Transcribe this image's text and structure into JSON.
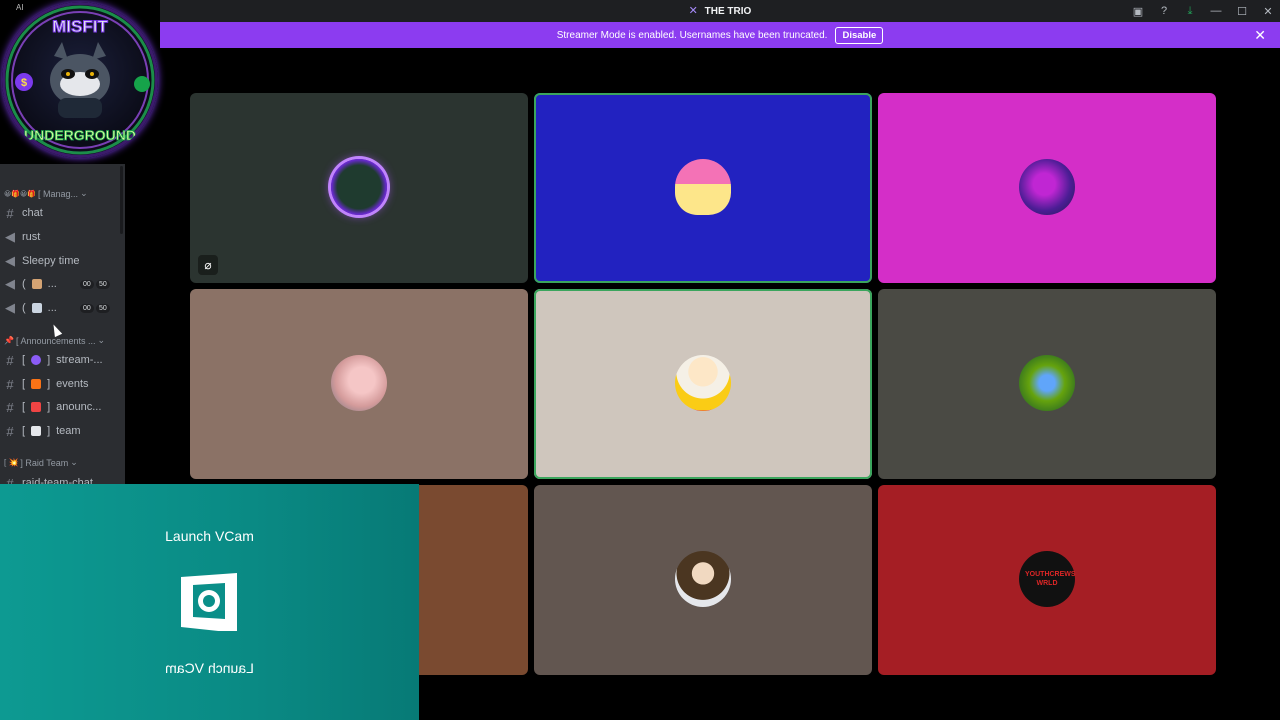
{
  "window": {
    "title": "THE TRIO",
    "controls": [
      "inbox-icon",
      "help-icon",
      "download-icon",
      "minimize-icon",
      "maximize-icon",
      "close-icon"
    ]
  },
  "banner": {
    "message": "Streamer Mode is enabled. Usernames have been truncated.",
    "button_label": "Disable",
    "background": "#8c3cf0"
  },
  "server": {
    "ai_tag": "AI",
    "logo_top_text": "MISFIT",
    "logo_bottom_text": "UNDERGROUND"
  },
  "sidebar": {
    "categories": [
      {
        "label": "[ Manag...",
        "prefix": "😀🎁😀🎁"
      },
      {
        "label": "[ Announcements ...",
        "prefix": "📌"
      },
      {
        "label": "] Raid Team",
        "prefix": "[ 💥"
      }
    ],
    "channels": [
      {
        "type": "text",
        "name": "chat"
      },
      {
        "type": "voice",
        "name": "rust"
      },
      {
        "type": "voice",
        "name": "Sleepy time"
      },
      {
        "type": "voice",
        "name": "...",
        "count_a": "00",
        "count_b": "50"
      },
      {
        "type": "voice",
        "name": "...",
        "count_a": "00",
        "count_b": "50"
      },
      {
        "type": "text",
        "name": "stream-..."
      },
      {
        "type": "text",
        "name": "events"
      },
      {
        "type": "text",
        "name": "anounc..."
      },
      {
        "type": "text",
        "name": "team"
      },
      {
        "type": "text",
        "name": "raid-team-chat"
      }
    ]
  },
  "tiles": [
    {
      "bg": "#2b3430",
      "speaking": false,
      "muted": true,
      "avatar": "avatar-1"
    },
    {
      "bg": "#2222c0",
      "speaking": true,
      "muted": false,
      "avatar": "avatar-2"
    },
    {
      "bg": "#d42ec8",
      "speaking": false,
      "muted": false,
      "avatar": "avatar-3"
    },
    {
      "bg": "#8b7266",
      "speaking": false,
      "muted": false,
      "avatar": "avatar-4"
    },
    {
      "bg": "#cfc6bd",
      "speaking": true,
      "muted": false,
      "avatar": "avatar-5"
    },
    {
      "bg": "#4a4a44",
      "speaking": false,
      "muted": false,
      "avatar": "avatar-6"
    },
    {
      "bg": "#7a4a30",
      "speaking": false,
      "muted": false,
      "avatar": ""
    },
    {
      "bg": "#625650",
      "speaking": false,
      "muted": false,
      "avatar": "avatar-8"
    },
    {
      "bg": "#a51e24",
      "speaking": false,
      "muted": false,
      "avatar": "avatar-9",
      "avatar_text": "YOUTHCREWS WRLD"
    }
  ],
  "vcam": {
    "title": "Launch VCam",
    "title_mirrored": "Launch VCam",
    "bg": "#0d9a92"
  }
}
